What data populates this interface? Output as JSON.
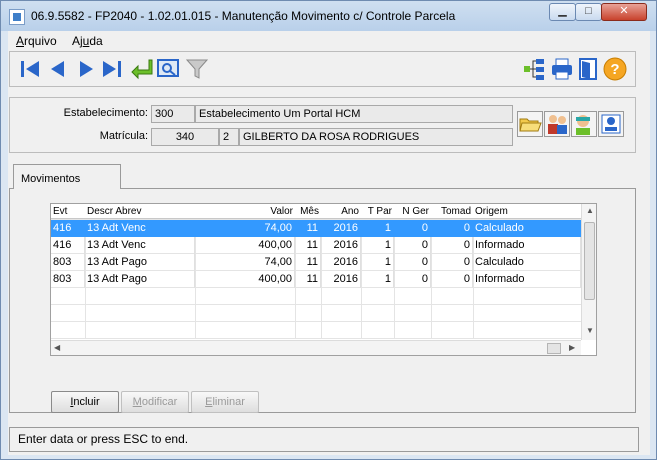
{
  "window": {
    "title": "06.9.5582 - FP2040 - 1.02.01.015 - Manutenção Movimento c/ Controle Parcela",
    "min_label": "▁",
    "max_label": "□",
    "close_label": "✕"
  },
  "menu": {
    "arquivo_first": "A",
    "arquivo_rest": "rquivo",
    "ajuda_first": "Aj",
    "ajuda_u": "u",
    "ajuda_rest": "da"
  },
  "toolbar": {
    "icons": [
      "first-record-icon",
      "previous-record-icon",
      "next-record-icon",
      "last-record-icon",
      "goto-icon",
      "search-icon",
      "filter-icon",
      "tree-icon",
      "print-icon",
      "exit-icon",
      "help-icon"
    ],
    "help_glyph": "?"
  },
  "header": {
    "estabelecimento_label": "Estabelecimento:",
    "estabelecimento_code": "300",
    "estabelecimento_name": "Estabelecimento Um Portal HCM",
    "matricula_label": "Matrícula:",
    "matricula_value": "340",
    "matricula_digit": "2",
    "employee_name": "GILBERTO DA ROSA RODRIGUES"
  },
  "tab": {
    "label": "Movimentos"
  },
  "grid": {
    "columns": [
      "Evt",
      "Descr Abrev",
      "Valor",
      "Mês",
      "Ano",
      "T Par",
      "N Ger",
      "Tomad",
      "Origem"
    ],
    "rows": [
      [
        "416",
        "13 Adt Venc",
        "74,00",
        "11",
        "2016",
        "1",
        "0",
        "0",
        "Calculado"
      ],
      [
        "416",
        "13 Adt Venc",
        "400,00",
        "11",
        "2016",
        "1",
        "0",
        "0",
        "Informado"
      ],
      [
        "803",
        "13 Adt Pago",
        "74,00",
        "11",
        "2016",
        "1",
        "0",
        "0",
        "Calculado"
      ],
      [
        "803",
        "13 Adt Pago",
        "400,00",
        "11",
        "2016",
        "1",
        "0",
        "0",
        "Informado"
      ]
    ],
    "selected_row": 0
  },
  "actions": {
    "incluir_u": "I",
    "incluir_rest": "ncluir",
    "modificar_u": "M",
    "modificar_rest": "odificar",
    "eliminar_u": "E",
    "eliminar_rest": "liminar"
  },
  "status": {
    "text": "Enter data or press ESC to end."
  },
  "colors": {
    "selection": "#3399ff",
    "nav_arrows": "#2a66c9",
    "help": "#f5a623"
  }
}
